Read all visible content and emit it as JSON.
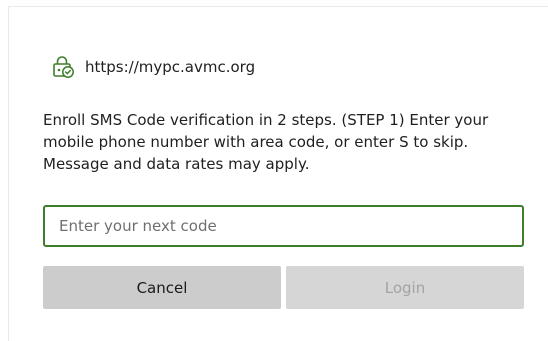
{
  "site": {
    "url": "https://mypc.avmc.org",
    "icon": "lock-check-icon",
    "icon_color": "#3e7d2a"
  },
  "prompt": {
    "message": "Enroll SMS Code verification in 2 steps. (STEP 1) Enter your mobile phone number with area code, or enter S to skip. Message and data rates may apply."
  },
  "code_input": {
    "value": "",
    "placeholder": "Enter your next code"
  },
  "buttons": {
    "cancel_label": "Cancel",
    "login_label": "Login",
    "login_enabled": false
  },
  "colors": {
    "accent": "#3e7d2a",
    "button_bg": "#cccccc",
    "disabled_text": "#a3a3a3"
  }
}
